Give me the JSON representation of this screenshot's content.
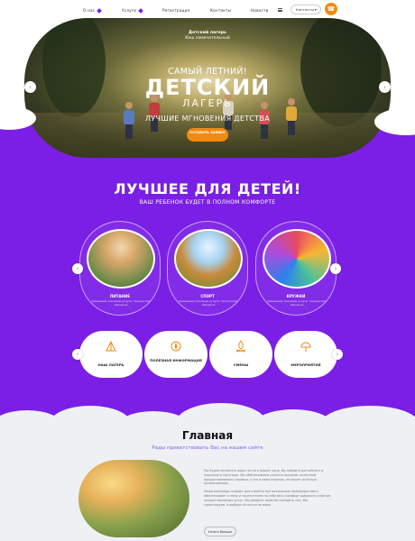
{
  "nav": {
    "items": [
      {
        "label": "О нас"
      },
      {
        "label": "Услуги"
      },
      {
        "label": "Регистрация"
      },
      {
        "label": "Контакты"
      },
      {
        "label": "Новости"
      }
    ],
    "contacts_label": "Контакты",
    "menu_icon": "hamburger-icon",
    "phone_icon": "phone-icon"
  },
  "hero": {
    "brand_name": "Детский лагерь",
    "brand_tagline": "Ваш замечательный",
    "subtitle": "САМЫЙ ЛЕТНИЙ!",
    "title": "ДЕТСКИЙ",
    "title2": "ЛАГЕРЬ",
    "slogan": "ЛУЧШИЕ МГНОВЕНИЯ ДЕТСТВА",
    "cta": "ОСТАВИТЬ ЗАЯВКУ",
    "prev_icon": "chevron-left-icon",
    "next_icon": "chevron-right-icon"
  },
  "best": {
    "title": "ЛУЧШЕЕ ДЛЯ ДЕТЕЙ!",
    "subtitle": "ВАШ РЕБЕНОК БУДЕТ В ПОЛНОМ КОМФОРТЕ",
    "cards": [
      {
        "name": "ПИТАНИЕ",
        "desc": "примерное описание услуги, технологии, процесса"
      },
      {
        "name": "СПОРТ",
        "desc": "примерное описание услуги, технологии, процесса"
      },
      {
        "name": "КРУЖКИ",
        "desc": "примерное описание услуги, технологии, процесса"
      }
    ],
    "features": [
      {
        "label": "НАШ ЛАГЕРЬ",
        "icon": "camp-icon"
      },
      {
        "label": "ПОЛЕЗНАЯ ИНФОРМАЦИЯ",
        "icon": "compass-icon"
      },
      {
        "label": "СМЕНЫ",
        "icon": "campfire-icon"
      },
      {
        "label": "МЕРОПРИЯТИЯ",
        "icon": "event-icon"
      }
    ]
  },
  "main": {
    "title": "Главная",
    "subtitle": "Рады приветствовать Вас на нашем сайте",
    "paragraph1": "Мы будем искренне рады гостю в нашем лице. Вы найдете достойного и надежного партнера. Мы обеспечиваем клиента высоким качеством предоставляемого сервиса, а это в свою очередь, не может остаться незамеченным.",
    "paragraph2": "Наша компания создает для клиента все возможные преимущества и обеспечивает к нему и посетителям на себя весь комфорт широкого спектра предоставляемых услуг. Вы увидите заметно понадеть нас. Мы гарантируем, в выборе остаться на вами.",
    "more": "Узнать больше"
  },
  "colors": {
    "accent": "#7b1fe6",
    "orange": "#f28a12",
    "light_bg": "#eef0f3"
  }
}
